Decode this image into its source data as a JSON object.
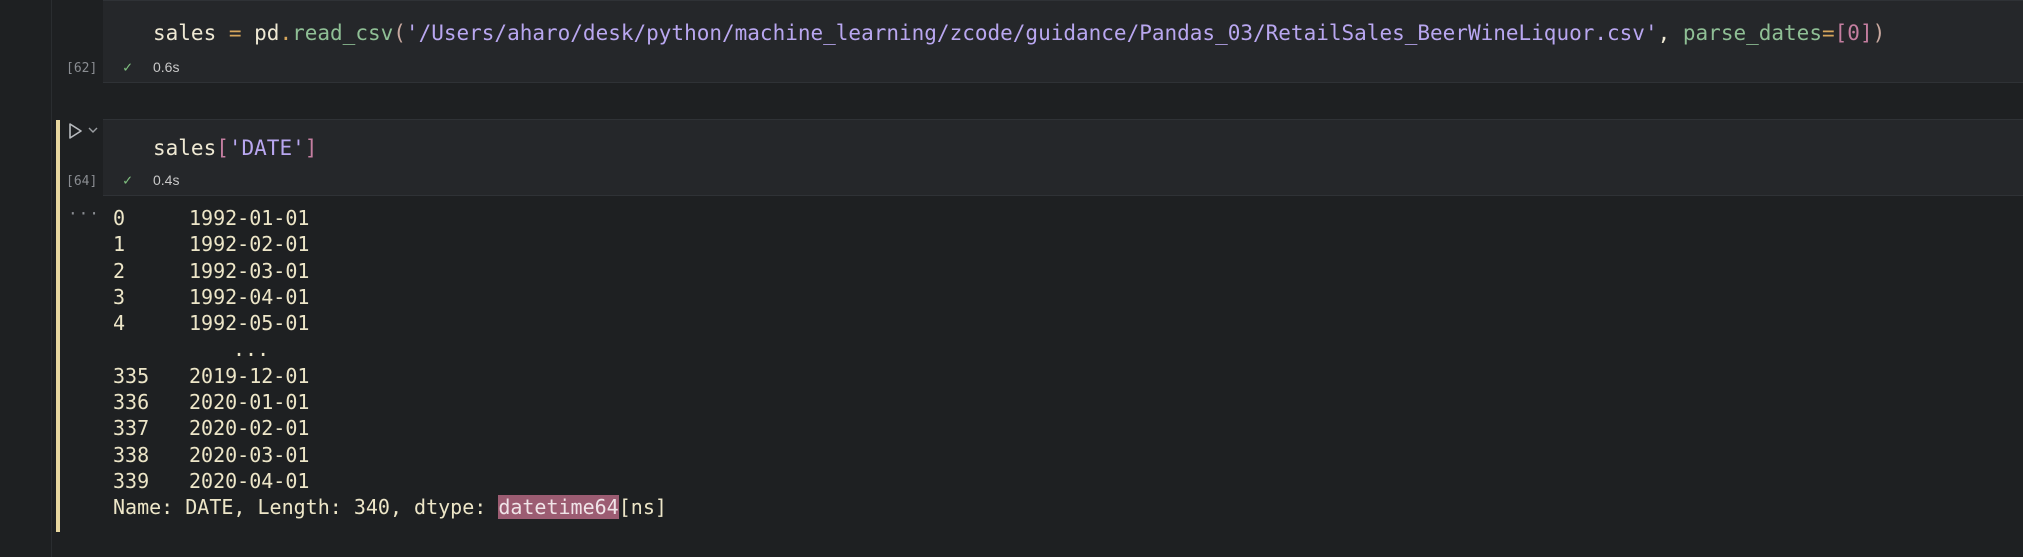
{
  "cells": [
    {
      "exec_count": "[62]",
      "code": {
        "var": "sales",
        "eq": " = ",
        "obj": "pd",
        "dot": ".",
        "fn": "read_csv",
        "lparen": "(",
        "path": "'/Users/aharo/desk/python/machine_learning/zcode/guidance/Pandas_03/RetailSales_BeerWineLiquor.csv'",
        "comma": ", ",
        "kw": "parse_dates",
        "kweq": "=",
        "lbr": "[",
        "num": "0",
        "rbr": "]",
        "rparen": ")"
      },
      "status_time": "0.6s"
    },
    {
      "exec_count": "[64]",
      "code": {
        "var": "sales",
        "lbr": "[",
        "key": "'DATE'",
        "rbr": "]"
      },
      "status_time": "0.4s"
    }
  ],
  "output": {
    "more_label": "···",
    "rows_head": [
      {
        "idx": "0",
        "val": "1992-01-01"
      },
      {
        "idx": "1",
        "val": "1992-02-01"
      },
      {
        "idx": "2",
        "val": "1992-03-01"
      },
      {
        "idx": "3",
        "val": "1992-04-01"
      },
      {
        "idx": "4",
        "val": "1992-05-01"
      }
    ],
    "ellipsis": "...",
    "rows_tail": [
      {
        "idx": "335",
        "val": "2019-12-01"
      },
      {
        "idx": "336",
        "val": "2020-01-01"
      },
      {
        "idx": "337",
        "val": "2020-02-01"
      },
      {
        "idx": "338",
        "val": "2020-03-01"
      },
      {
        "idx": "339",
        "val": "2020-04-01"
      }
    ],
    "footer_prefix": "Name: DATE, Length: 340, dtype: ",
    "footer_highlight": "datetime64",
    "footer_suffix": "[ns]"
  },
  "icons": {
    "check": "check-icon",
    "run": "play-icon",
    "chevron": "chevron-down-icon"
  },
  "colors": {
    "background": "#1e2022",
    "cell_background": "#25272a",
    "active_bar": "#e8d7a0",
    "highlight": "#9c5c72"
  }
}
